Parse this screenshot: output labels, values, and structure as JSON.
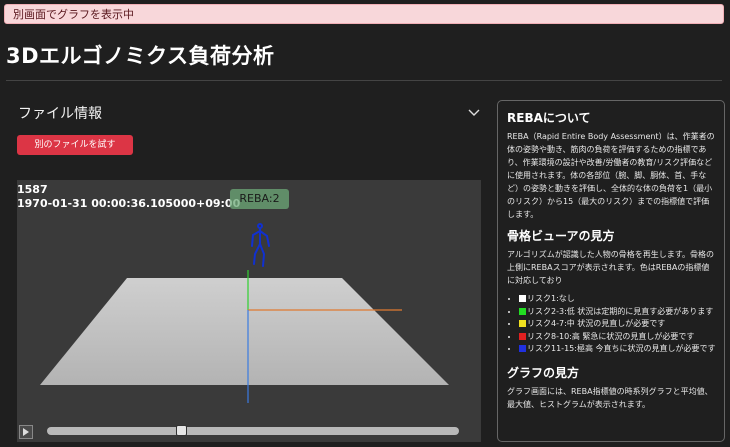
{
  "notice": "別画面でグラフを表示中",
  "page_title": "3Dエルゴノミクス負荷分析",
  "file_section": {
    "title": "ファイル情報",
    "try_other_label": "別のファイルを試す"
  },
  "viewer": {
    "frame_number": "1587",
    "timestamp": "1970-01-31 00:00:36.105000+09:00",
    "reba_label": "REBA:2",
    "slider_progress": 0.32
  },
  "info": {
    "about_title": "REBAについて",
    "about_text": "REBA（Rapid Entire Body Assessment）は、作業者の体の姿勢や動き、筋肉の負荷を評価するための指標であり、作業環境の設計や改善/労働者の教育/リスク評価などに使用されます。体の各部位（腕、脚、胴体、首、手など）の姿勢と動きを評価し、全体的な体の負荷を1（最小のリスク）から15（最大のリスク）までの指標値で評価します。",
    "skeleton_title": "骨格ビューアの見方",
    "skeleton_text": "アルゴリズムが認識した人物の骨格を再生します。骨格の上側にREBAスコアが表示されます。色はREBAの指標値に対応しており",
    "risk_items": [
      {
        "label": "リスク1:なし",
        "color": "#ffffff"
      },
      {
        "label": "リスク2-3:低 状況は定期的に見直す必要があります",
        "color": "#22dd22"
      },
      {
        "label": "リスク4-7:中 状況の見直しが必要です",
        "color": "#f0e020"
      },
      {
        "label": "リスク8-10:高 緊急に状況の見直しが必要です",
        "color": "#e02020"
      },
      {
        "label": "リスク11-15:極高 今直ちに状況の見直しが必要です",
        "color": "#2030e0"
      }
    ],
    "graph_title": "グラフの見方",
    "graph_text": "グラフ画面には、REBA指標値の時系列グラフと平均値、最大値、ヒストグラムが表示されます。"
  }
}
